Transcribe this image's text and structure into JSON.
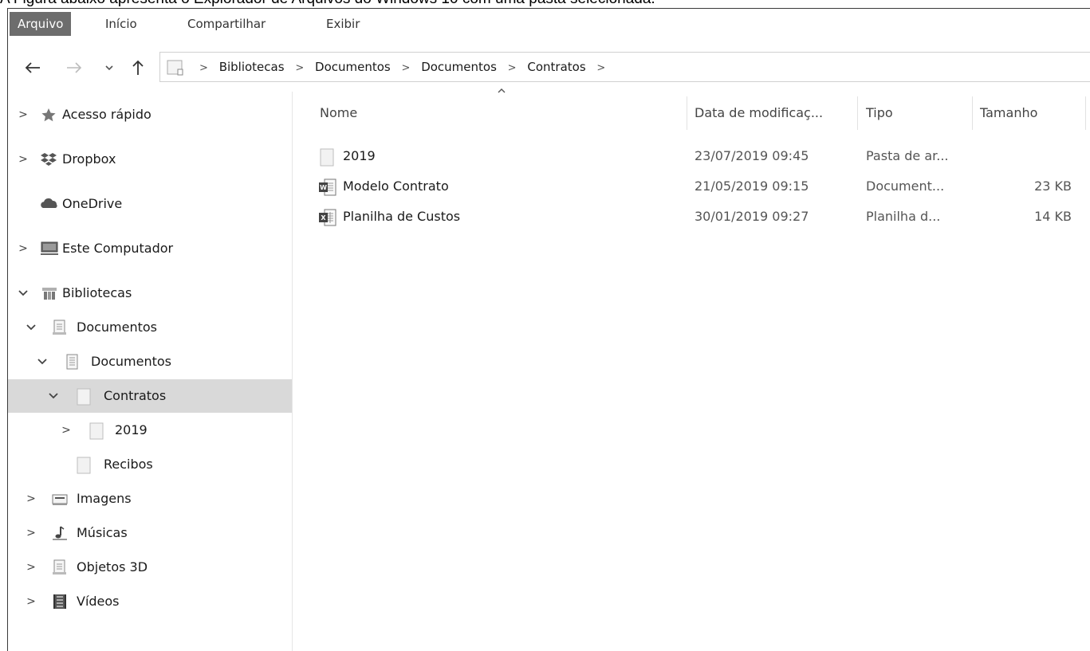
{
  "caption": "A Figura abaixo apresenta o Explorador de Arquivos do Windows 10 com uma pasta selecionada.",
  "ribbon": {
    "tabs": [
      "Arquivo",
      "Início",
      "Compartilhar",
      "Exibir"
    ]
  },
  "address": {
    "crumbs": [
      "Bibliotecas",
      "Documentos",
      "Documentos",
      "Contratos"
    ]
  },
  "tree": {
    "items": [
      {
        "label": "Acesso rápido",
        "icon": "star-icon"
      },
      {
        "label": "Dropbox",
        "icon": "dropbox-icon"
      },
      {
        "label": "OneDrive",
        "icon": "cloud-icon"
      },
      {
        "label": "Este Computador",
        "icon": "computer-icon"
      },
      {
        "label": "Bibliotecas",
        "icon": "library-icon"
      },
      {
        "label": "Documentos",
        "icon": "document-icon"
      },
      {
        "label": "Documentos",
        "icon": "document-icon"
      },
      {
        "label": "Contratos",
        "icon": "folder-icon"
      },
      {
        "label": "2019",
        "icon": "folder-icon"
      },
      {
        "label": "Recibos",
        "icon": "folder-icon"
      },
      {
        "label": "Imagens",
        "icon": "image-icon"
      },
      {
        "label": "Músicas",
        "icon": "music-icon"
      },
      {
        "label": "Objetos 3D",
        "icon": "cube-icon"
      },
      {
        "label": "Vídeos",
        "icon": "video-icon"
      }
    ],
    "selected": "Contratos"
  },
  "columns": {
    "name": "Nome",
    "date": "Data de modificaç...",
    "type": "Tipo",
    "size": "Tamanho"
  },
  "files": [
    {
      "name": "2019",
      "date": "23/07/2019 09:45",
      "type": "Pasta de ar...",
      "size": "",
      "icon": "folder-icon"
    },
    {
      "name": "Modelo Contrato",
      "date": "21/05/2019 09:15",
      "type": "Document...",
      "size": "23 KB",
      "icon": "word-document-icon"
    },
    {
      "name": "Planilha de Custos",
      "date": "30/01/2019 09:27",
      "type": "Planilha d...",
      "size": "14 KB",
      "icon": "excel-spreadsheet-icon"
    }
  ],
  "colors": {
    "selected_bg": "#d9d9d9",
    "file_tab_bg": "#6d6d6d"
  }
}
